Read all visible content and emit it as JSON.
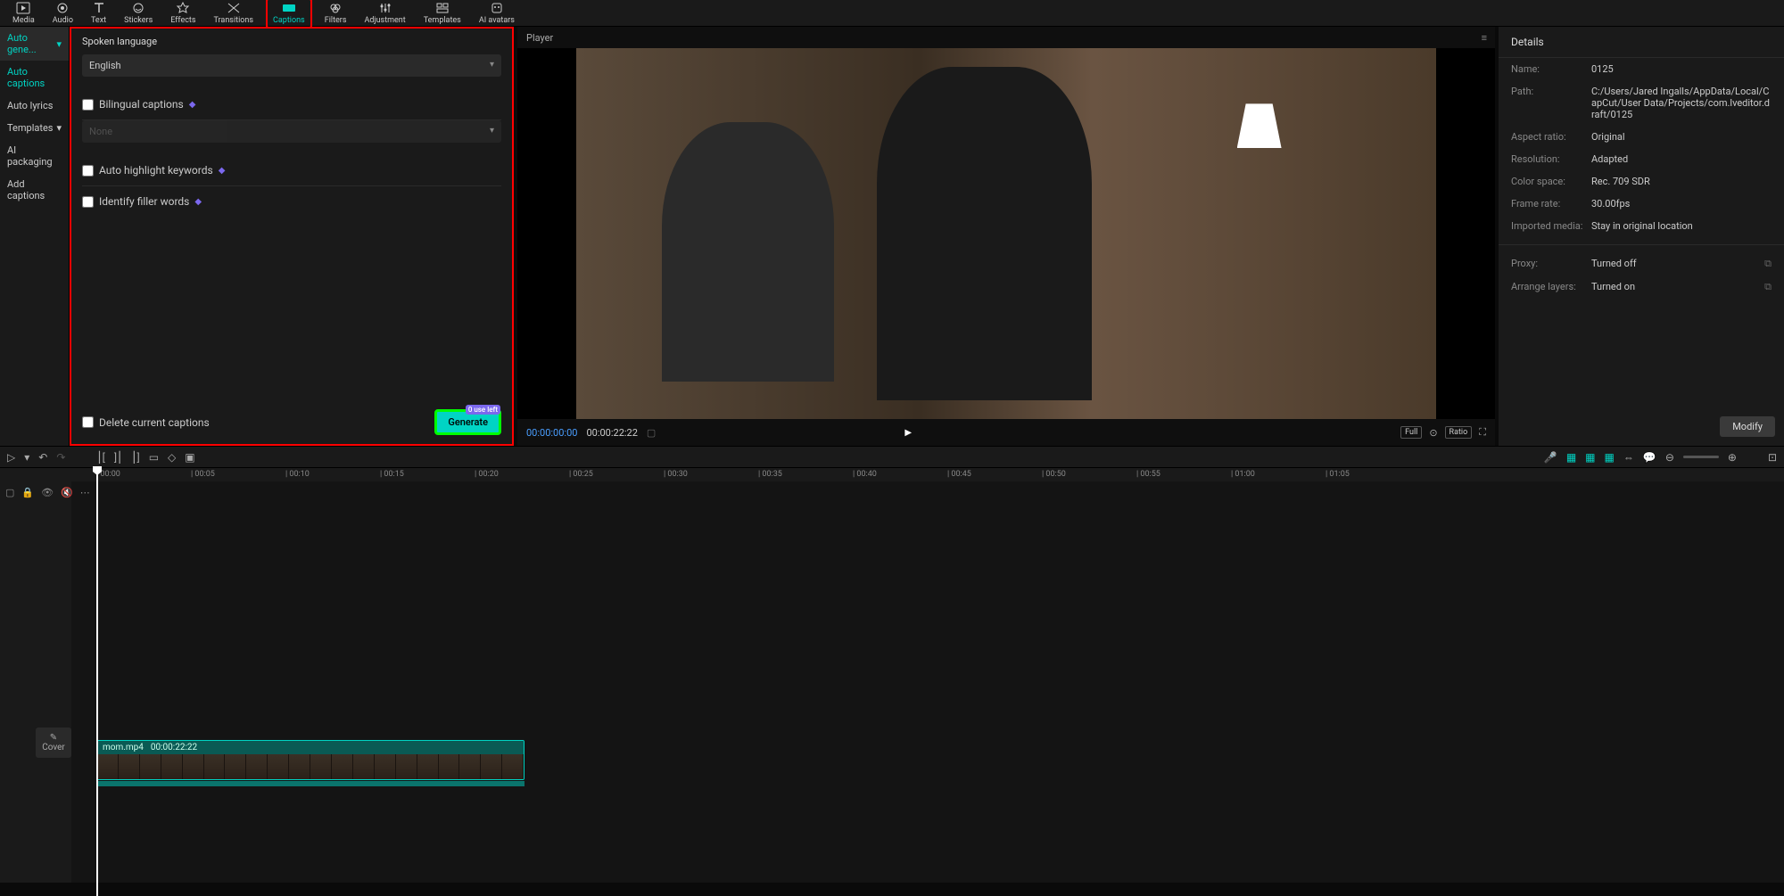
{
  "top_tabs": [
    "Media",
    "Audio",
    "Text",
    "Stickers",
    "Effects",
    "Transitions",
    "Captions",
    "Filters",
    "Adjustment",
    "Templates",
    "AI avatars"
  ],
  "top_active": 6,
  "sub_tabs": {
    "auto_gene": "Auto gene...",
    "auto_captions": "Auto captions",
    "auto_lyrics": "Auto lyrics",
    "templates": "Templates",
    "ai_packaging": "AI packaging",
    "add_captions": "Add captions"
  },
  "options": {
    "spoken_language_label": "Spoken language",
    "spoken_language_value": "English",
    "bilingual_label": "Bilingual captions",
    "bilingual_value": "None",
    "highlight_label": "Auto highlight keywords",
    "filler_label": "Identify filler words",
    "delete_label": "Delete current captions",
    "generate_label": "Generate",
    "generate_badge": "0 use left"
  },
  "player": {
    "title": "Player",
    "time_current": "00:00:00:00",
    "time_duration": "00:00:22:22",
    "full": "Full",
    "ratio": "Ratio"
  },
  "details": {
    "title": "Details",
    "name_k": "Name:",
    "name_v": "0125",
    "path_k": "Path:",
    "path_v": "C:/Users/Jared Ingalls/AppData/Local/CapCut/User Data/Projects/com.lveditor.draft/0125",
    "aspect_k": "Aspect ratio:",
    "aspect_v": "Original",
    "resolution_k": "Resolution:",
    "resolution_v": "Adapted",
    "colorspace_k": "Color space:",
    "colorspace_v": "Rec. 709 SDR",
    "framerate_k": "Frame rate:",
    "framerate_v": "30.00fps",
    "imported_k": "Imported media:",
    "imported_v": "Stay in original location",
    "proxy_k": "Proxy:",
    "proxy_v": "Turned off",
    "arrange_k": "Arrange layers:",
    "arrange_v": "Turned on",
    "modify": "Modify"
  },
  "ruler_ticks": [
    "00:00",
    "00:05",
    "00:10",
    "00:15",
    "00:20",
    "00:25",
    "00:30",
    "00:35",
    "00:40",
    "00:45",
    "00:50",
    "00:55",
    "01:00",
    "01:05"
  ],
  "clip": {
    "filename": "mom.mp4",
    "duration": "00:00:22:22"
  },
  "cover_label": "Cover"
}
